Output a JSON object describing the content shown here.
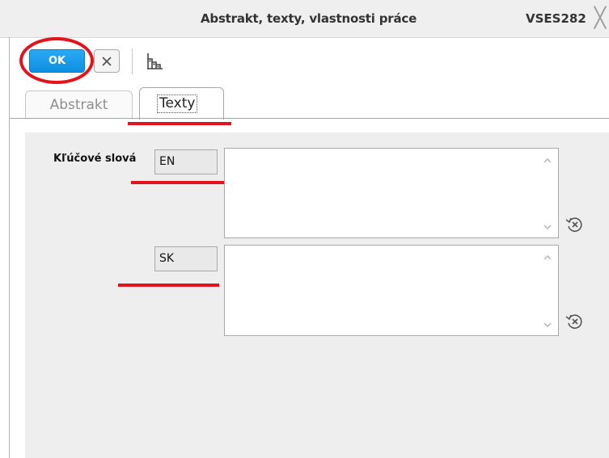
{
  "window": {
    "title": "Abstrakt, texty, vlastnosti práce",
    "code": "VSES282",
    "close_icon": "close-x-icon"
  },
  "toolbar": {
    "ok_label": "OK",
    "cancel_icon": "close-icon",
    "tree_icon": "hierarchy-icon"
  },
  "tabs": [
    {
      "label": "Abstrakt",
      "active": false
    },
    {
      "label": "Texty",
      "active": true
    }
  ],
  "form": {
    "keywords_label": "Kľúčové slová",
    "fields": [
      {
        "language": "EN",
        "value": ""
      },
      {
        "language": "SK",
        "value": ""
      }
    ],
    "reset_icon": "reset-clear-icon"
  },
  "annotation_color": "#e4121a",
  "accent_color": "#1a9be8"
}
